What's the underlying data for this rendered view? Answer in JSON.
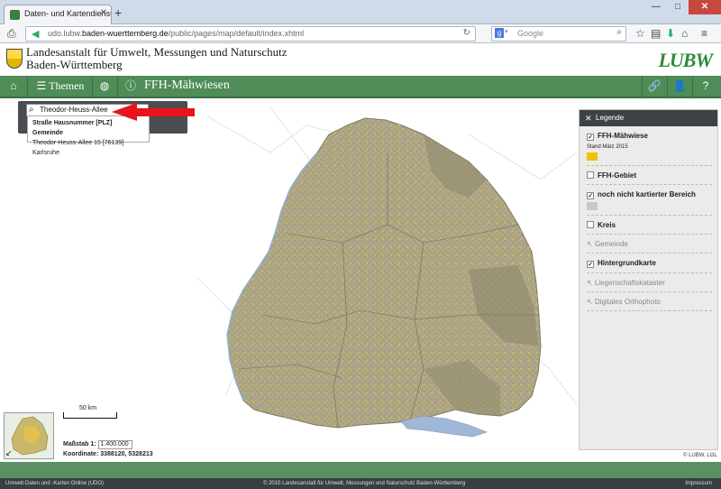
{
  "browser": {
    "tab_title": "Daten- und Kartendienst d...",
    "url_prefix": "udo.lubw.",
    "url_domain": "baden-wuerttemberg.de",
    "url_path": "/public/pages/map/default/index.xhtml",
    "search_placeholder": "Google"
  },
  "header": {
    "org_line1": "Landesanstalt für Umwelt, Messungen und Naturschutz",
    "org_line2": "Baden-Württemberg",
    "logo_text": "LUBW"
  },
  "toolbar": {
    "themes_label": "Themen",
    "title": "FFH-Mähwiesen"
  },
  "search": {
    "value": "Theodor-Heuss-Allee",
    "suggest_header": "Straße Hausnummer [PLZ] Gemeinde",
    "suggest_item": "Theodor-Heuss-Allee 15 [76139] Karlsruhe"
  },
  "legend": {
    "title": "Legende",
    "items": [
      {
        "label": "FFH-Mähwiese",
        "checked": true,
        "sub": "Stand März 2015",
        "color": "#f2c200"
      },
      {
        "label": "FFH-Gebiet",
        "checked": false
      },
      {
        "label": "noch nicht kartierter Bereich",
        "checked": true,
        "color": "#c8c8c8"
      },
      {
        "label": "Kreis",
        "checked": false
      },
      {
        "label": "Gemeinde",
        "disabled": true
      },
      {
        "label": "Hintergrundkarte",
        "checked": true
      },
      {
        "label": "Liegenschaftskataster",
        "disabled": true
      },
      {
        "label": "Digitales Orthophoto",
        "disabled": true
      }
    ]
  },
  "map": {
    "scalebar_label": "50 km",
    "scale_label": "Maßstab",
    "scale_prefix": "1:",
    "scale_value": "1.400.000",
    "coords_label": "Koordinate:",
    "coords_value": "3388120, 5328213",
    "copyright": "© LUBW, LGL"
  },
  "footer": {
    "left": "Umwelt-Daten und -Karten Online (UDO)",
    "center": "© 2015 Landesanstalt für Umwelt, Messungen und Naturschutz Baden-Württemberg",
    "right": "Impressum"
  },
  "colors": {
    "accent_green": "#4f8c58",
    "meadow_yellow": "#f2c200",
    "unmapped_gray": "#c8c8c8"
  }
}
